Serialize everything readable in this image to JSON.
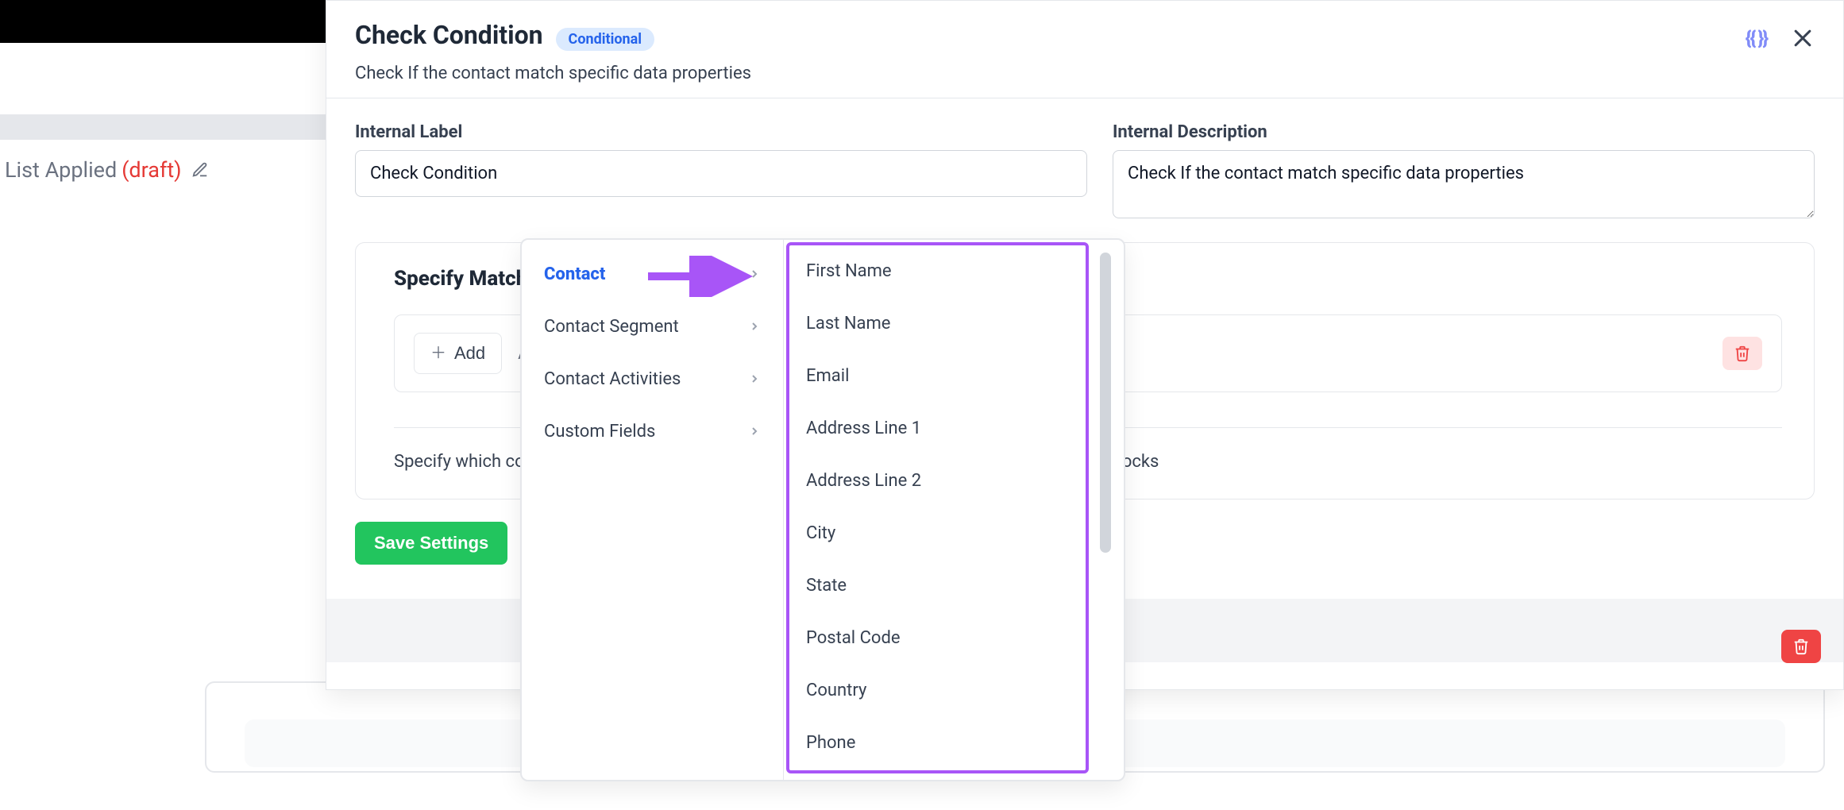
{
  "background": {
    "title_name": "List Applied",
    "title_status": "(draft)"
  },
  "modal": {
    "title": "Check Condition",
    "badge": "Conditional",
    "subtitle": "Check If the contact match specific data properties",
    "internal_label_heading": "Internal Label",
    "internal_label_value": "Check Condition",
    "internal_desc_heading": "Internal Description",
    "internal_desc_value": "Check If the contact match specific data properties",
    "card": {
      "heading": "Specify Matchi",
      "add_label": "Add",
      "add_placeholder": "A",
      "desc_suffix": "ks or no blocks"
    },
    "save_label": "Save Settings"
  },
  "popover": {
    "categories": [
      "Contact",
      "Contact Segment",
      "Contact Activities",
      "Custom Fields"
    ],
    "fields": [
      "First Name",
      "Last Name",
      "Email",
      "Address Line 1",
      "Address Line 2",
      "City",
      "State",
      "Postal Code",
      "Country",
      "Phone"
    ]
  }
}
